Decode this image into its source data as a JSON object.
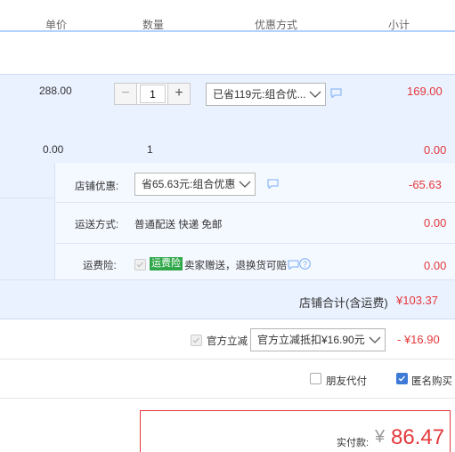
{
  "header": {
    "unit_price": "单价",
    "quantity": "数量",
    "discount_method": "优惠方式",
    "subtotal": "小计"
  },
  "item": {
    "price": "288.00",
    "quantity": "1",
    "discount_select": "已省119元:组合优...",
    "subtotal": "169.00"
  },
  "addon": {
    "price": "0.00",
    "quantity": "1",
    "subtotal": "0.00"
  },
  "shop_discount": {
    "label": "店铺优惠:",
    "select": "省65.63元:组合优惠",
    "amount": "-65.63"
  },
  "shipping": {
    "label": "运送方式:",
    "value": "普通配送 快递 免邮",
    "amount": "0.00"
  },
  "insurance": {
    "label": "运费险:",
    "badge": "运费险",
    "text": "卖家赠送，退换货可赔",
    "amount": "0.00"
  },
  "shop_total": {
    "label": "店铺合计(含运费)",
    "amount": "¥103.37"
  },
  "official": {
    "label": "官方立减",
    "select": "官方立减抵扣¥16.90元",
    "amount": "- ¥16.90"
  },
  "options": {
    "friend_pay": "朋友代付",
    "anonymous": "匿名购买"
  },
  "payment": {
    "label": "实付款:",
    "currency": "¥",
    "amount": "86.47"
  },
  "colors": {
    "accent_red": "#e4393c",
    "header_border": "#b2d1ff",
    "row_bg": "#eaf1ff",
    "badge_green": "#2fa749",
    "checkbox_blue": "#3d7ad6"
  }
}
